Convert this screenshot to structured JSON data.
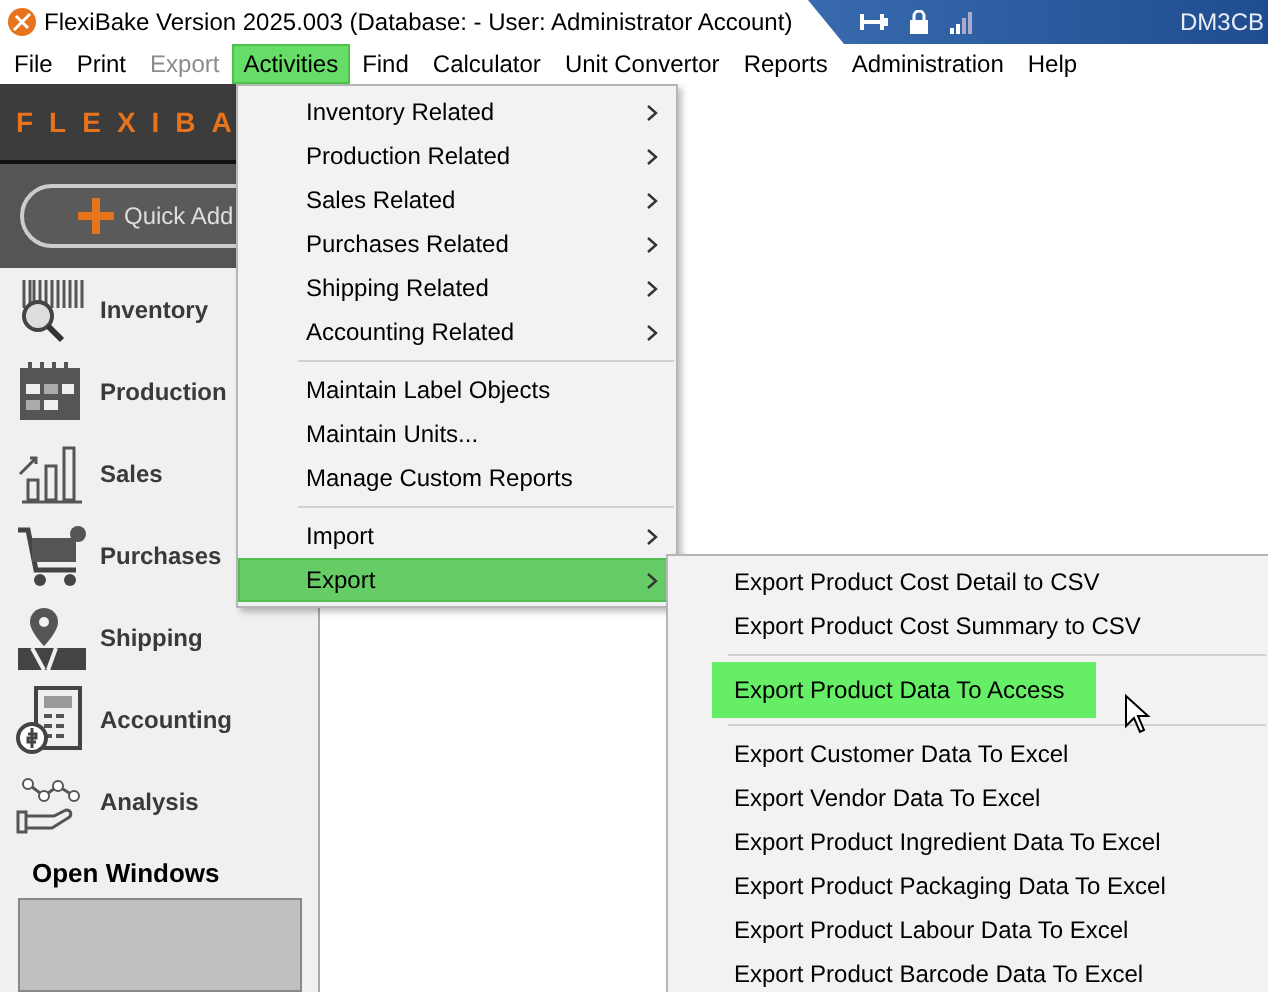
{
  "window": {
    "title": "FlexiBake Version 2025.003 (Database:  - User: Administrator Account)",
    "machine": "DM3CB"
  },
  "menu_bar": [
    {
      "label": "File",
      "disabled": false,
      "selected": false
    },
    {
      "label": "Print",
      "disabled": false,
      "selected": false
    },
    {
      "label": "Export",
      "disabled": true,
      "selected": false
    },
    {
      "label": "Activities",
      "disabled": false,
      "selected": true
    },
    {
      "label": "Find",
      "disabled": false,
      "selected": false
    },
    {
      "label": "Calculator",
      "disabled": false,
      "selected": false
    },
    {
      "label": "Unit Convertor",
      "disabled": false,
      "selected": false
    },
    {
      "label": "Reports",
      "disabled": false,
      "selected": false
    },
    {
      "label": "Administration",
      "disabled": false,
      "selected": false
    },
    {
      "label": "Help",
      "disabled": false,
      "selected": false
    }
  ],
  "sidebar": {
    "logo": "FLEXIBA",
    "quick_add": "Quick Add",
    "items": [
      {
        "label": "Inventory"
      },
      {
        "label": "Production"
      },
      {
        "label": "Sales"
      },
      {
        "label": "Purchases"
      },
      {
        "label": "Shipping"
      },
      {
        "label": "Accounting"
      },
      {
        "label": "Analysis"
      }
    ],
    "open_windows": "Open Windows"
  },
  "activities_menu": [
    {
      "kind": "item",
      "label": "Inventory Related",
      "submenu": true,
      "selected": false
    },
    {
      "kind": "item",
      "label": "Production Related",
      "submenu": true,
      "selected": false
    },
    {
      "kind": "item",
      "label": "Sales Related",
      "submenu": true,
      "selected": false
    },
    {
      "kind": "item",
      "label": "Purchases Related",
      "submenu": true,
      "selected": false
    },
    {
      "kind": "item",
      "label": "Shipping Related",
      "submenu": true,
      "selected": false
    },
    {
      "kind": "item",
      "label": "Accounting Related",
      "submenu": true,
      "selected": false
    },
    {
      "kind": "separator"
    },
    {
      "kind": "item",
      "label": "Maintain Label Objects",
      "submenu": false,
      "selected": false
    },
    {
      "kind": "item",
      "label": "Maintain Units...",
      "submenu": false,
      "selected": false
    },
    {
      "kind": "item",
      "label": "Manage Custom Reports",
      "submenu": false,
      "selected": false
    },
    {
      "kind": "separator"
    },
    {
      "kind": "item",
      "label": "Import",
      "submenu": true,
      "selected": false
    },
    {
      "kind": "item",
      "label": "Export",
      "submenu": true,
      "selected": true
    }
  ],
  "export_menu": [
    {
      "kind": "item",
      "label": "Export Product Cost Detail to CSV",
      "selected": false
    },
    {
      "kind": "item",
      "label": "Export Product Cost Summary to CSV",
      "selected": false
    },
    {
      "kind": "separator"
    },
    {
      "kind": "item",
      "label": "Export Product Data To Access",
      "selected": true
    },
    {
      "kind": "separator"
    },
    {
      "kind": "item",
      "label": "Export Customer Data To Excel",
      "selected": false
    },
    {
      "kind": "item",
      "label": "Export Vendor Data To Excel",
      "selected": false
    },
    {
      "kind": "item",
      "label": "Export Product Ingredient Data To Excel",
      "selected": false
    },
    {
      "kind": "item",
      "label": "Export Product Packaging Data To Excel",
      "selected": false
    },
    {
      "kind": "item",
      "label": "Export Product Labour Data To Excel",
      "selected": false
    },
    {
      "kind": "item",
      "label": "Export Product Barcode Data To Excel",
      "selected": false
    }
  ]
}
